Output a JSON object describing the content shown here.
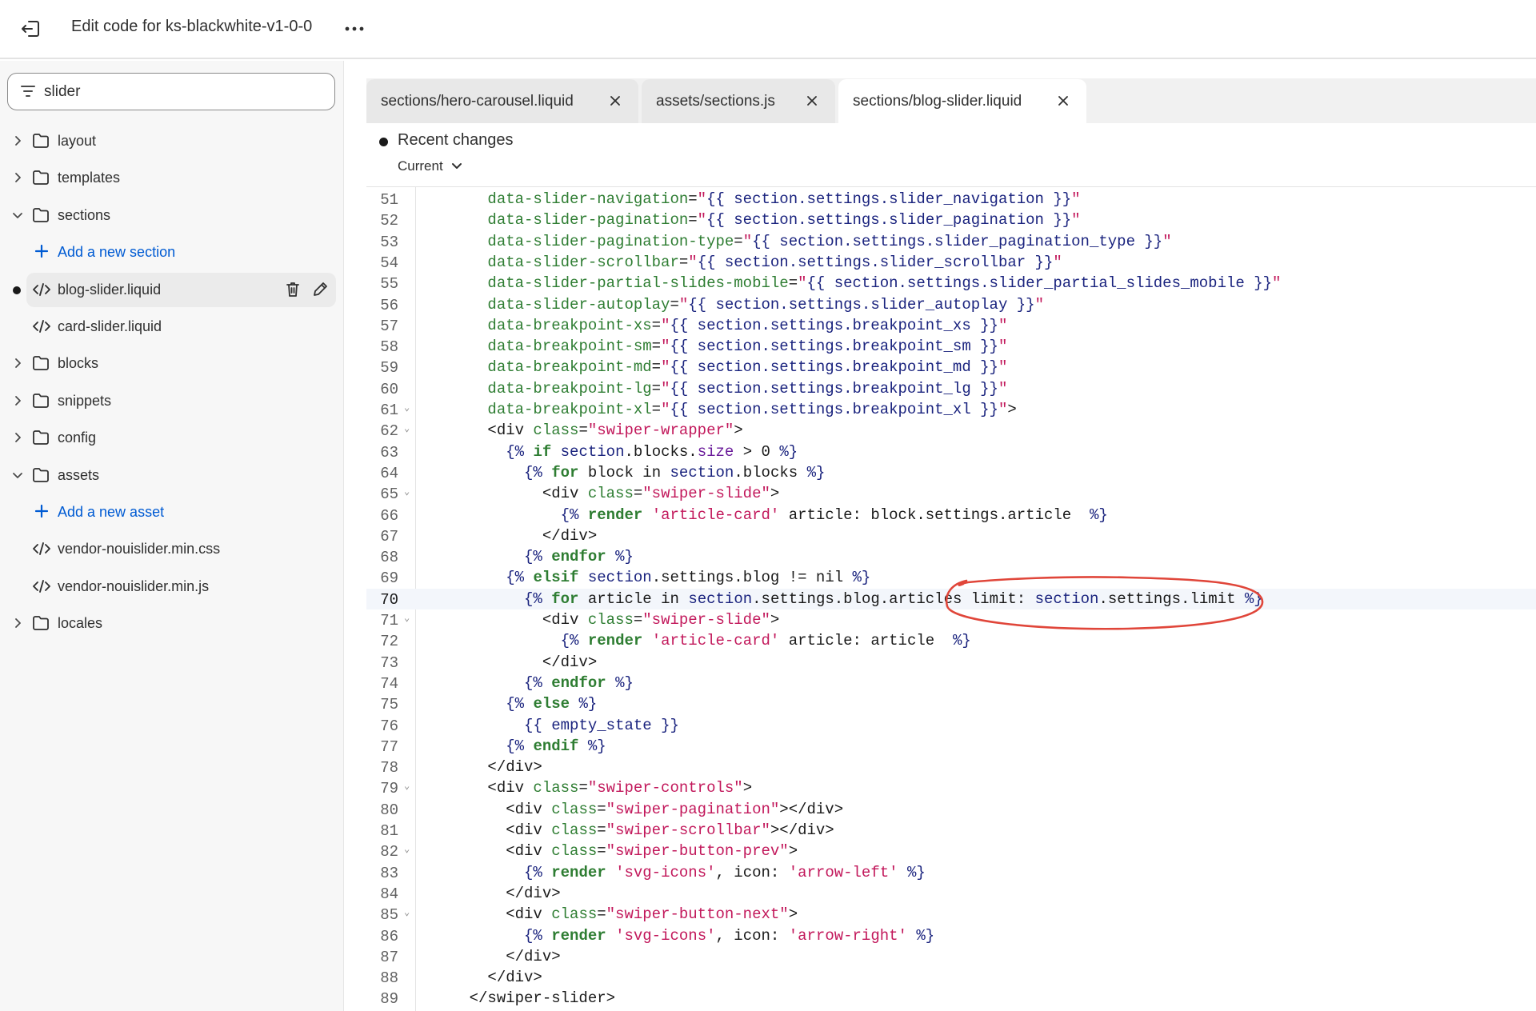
{
  "header": {
    "back_icon": "exit-icon",
    "title": "Edit code for ks-blackwhite-v1-0-0",
    "more_icon": "ellipsis-icon"
  },
  "sidebar": {
    "search": {
      "value": "slider",
      "icon": "filter-icon"
    },
    "items": [
      {
        "kind": "folder",
        "label": "layout",
        "expanded": false
      },
      {
        "kind": "folder",
        "label": "templates",
        "expanded": false
      },
      {
        "kind": "folder",
        "label": "sections",
        "expanded": true
      },
      {
        "kind": "action",
        "label": "Add a new section"
      },
      {
        "kind": "file",
        "label": "blog-slider.liquid",
        "selected": true,
        "modified": true
      },
      {
        "kind": "file",
        "label": "card-slider.liquid"
      },
      {
        "kind": "folder",
        "label": "blocks",
        "expanded": false
      },
      {
        "kind": "folder",
        "label": "snippets",
        "expanded": false
      },
      {
        "kind": "folder",
        "label": "config",
        "expanded": false
      },
      {
        "kind": "folder",
        "label": "assets",
        "expanded": true
      },
      {
        "kind": "action",
        "label": "Add a new asset"
      },
      {
        "kind": "file",
        "label": "vendor-nouislider.min.css"
      },
      {
        "kind": "file",
        "label": "vendor-nouislider.min.js"
      },
      {
        "kind": "folder",
        "label": "locales",
        "expanded": false
      }
    ]
  },
  "tabs": [
    {
      "label": "sections/hero-carousel.liquid",
      "active": false
    },
    {
      "label": "assets/sections.js",
      "active": false
    },
    {
      "prefix": "sections/",
      "name": "blog-slider.liquid",
      "active": true
    }
  ],
  "changes": {
    "title": "Recent changes",
    "version": "Current"
  },
  "code": {
    "first_line": 51,
    "highlighted_line": 70,
    "fold_lines": [
      61,
      62,
      65,
      71,
      79,
      82,
      85
    ],
    "lines": [
      "      data-slider-navigation=\"{{ section.settings.slider_navigation }}\"",
      "      data-slider-pagination=\"{{ section.settings.slider_pagination }}\"",
      "      data-slider-pagination-type=\"{{ section.settings.slider_pagination_type }}\"",
      "      data-slider-scrollbar=\"{{ section.settings.slider_scrollbar }}\"",
      "      data-slider-partial-slides-mobile=\"{{ section.settings.slider_partial_slides_mobile }}\"",
      "      data-slider-autoplay=\"{{ section.settings.slider_autoplay }}\"",
      "      data-breakpoint-xs=\"{{ section.settings.breakpoint_xs }}\"",
      "      data-breakpoint-sm=\"{{ section.settings.breakpoint_sm }}\"",
      "      data-breakpoint-md=\"{{ section.settings.breakpoint_md }}\"",
      "      data-breakpoint-lg=\"{{ section.settings.breakpoint_lg }}\"",
      "      data-breakpoint-xl=\"{{ section.settings.breakpoint_xl }}\">",
      "      <div class=\"swiper-wrapper\">",
      "        {% if section.blocks.size > 0 %}",
      "          {% for block in section.blocks %}",
      "            <div class=\"swiper-slide\">",
      "              {% render 'article-card' article: block.settings.article  %}",
      "            </div>",
      "          {% endfor %}",
      "        {% elsif section.settings.blog != nil %}",
      "          {% for article in section.settings.blog.articles limit: section.settings.limit %}",
      "            <div class=\"swiper-slide\">",
      "              {% render 'article-card' article: article  %}",
      "            </div>",
      "          {% endfor %}",
      "        {% else %}",
      "          {{ empty_state }}",
      "        {% endif %}",
      "      </div>",
      "      <div class=\"swiper-controls\">",
      "        <div class=\"swiper-pagination\"></div>",
      "        <div class=\"swiper-scrollbar\"></div>",
      "        <div class=\"swiper-button-prev\">",
      "          {% render 'svg-icons', icon: 'arrow-left' %}",
      "        </div>",
      "        <div class=\"swiper-button-next\">",
      "          {% render 'svg-icons', icon: 'arrow-right' %}",
      "        </div>",
      "      </div>",
      "    </swiper-slider>"
    ]
  },
  "annotation": {
    "color": "#e0463a",
    "shape": "hand-drawn ellipse",
    "target_line": 70
  }
}
